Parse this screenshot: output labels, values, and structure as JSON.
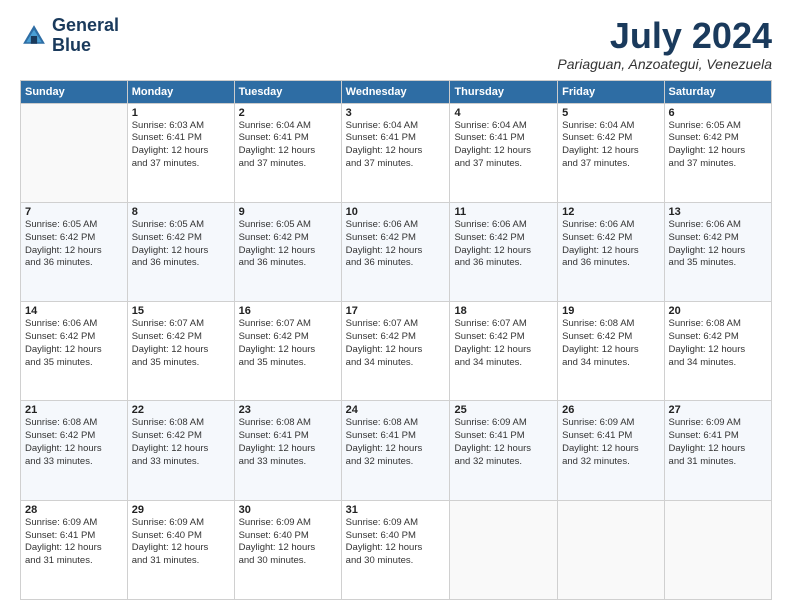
{
  "logo": {
    "line1": "General",
    "line2": "Blue"
  },
  "title": "July 2024",
  "subtitle": "Pariaguan, Anzoategui, Venezuela",
  "weekdays": [
    "Sunday",
    "Monday",
    "Tuesday",
    "Wednesday",
    "Thursday",
    "Friday",
    "Saturday"
  ],
  "weeks": [
    [
      {
        "day": "",
        "info": ""
      },
      {
        "day": "1",
        "info": "Sunrise: 6:03 AM\nSunset: 6:41 PM\nDaylight: 12 hours\nand 37 minutes."
      },
      {
        "day": "2",
        "info": "Sunrise: 6:04 AM\nSunset: 6:41 PM\nDaylight: 12 hours\nand 37 minutes."
      },
      {
        "day": "3",
        "info": "Sunrise: 6:04 AM\nSunset: 6:41 PM\nDaylight: 12 hours\nand 37 minutes."
      },
      {
        "day": "4",
        "info": "Sunrise: 6:04 AM\nSunset: 6:41 PM\nDaylight: 12 hours\nand 37 minutes."
      },
      {
        "day": "5",
        "info": "Sunrise: 6:04 AM\nSunset: 6:42 PM\nDaylight: 12 hours\nand 37 minutes."
      },
      {
        "day": "6",
        "info": "Sunrise: 6:05 AM\nSunset: 6:42 PM\nDaylight: 12 hours\nand 37 minutes."
      }
    ],
    [
      {
        "day": "7",
        "info": "Sunrise: 6:05 AM\nSunset: 6:42 PM\nDaylight: 12 hours\nand 36 minutes."
      },
      {
        "day": "8",
        "info": "Sunrise: 6:05 AM\nSunset: 6:42 PM\nDaylight: 12 hours\nand 36 minutes."
      },
      {
        "day": "9",
        "info": "Sunrise: 6:05 AM\nSunset: 6:42 PM\nDaylight: 12 hours\nand 36 minutes."
      },
      {
        "day": "10",
        "info": "Sunrise: 6:06 AM\nSunset: 6:42 PM\nDaylight: 12 hours\nand 36 minutes."
      },
      {
        "day": "11",
        "info": "Sunrise: 6:06 AM\nSunset: 6:42 PM\nDaylight: 12 hours\nand 36 minutes."
      },
      {
        "day": "12",
        "info": "Sunrise: 6:06 AM\nSunset: 6:42 PM\nDaylight: 12 hours\nand 36 minutes."
      },
      {
        "day": "13",
        "info": "Sunrise: 6:06 AM\nSunset: 6:42 PM\nDaylight: 12 hours\nand 35 minutes."
      }
    ],
    [
      {
        "day": "14",
        "info": "Sunrise: 6:06 AM\nSunset: 6:42 PM\nDaylight: 12 hours\nand 35 minutes."
      },
      {
        "day": "15",
        "info": "Sunrise: 6:07 AM\nSunset: 6:42 PM\nDaylight: 12 hours\nand 35 minutes."
      },
      {
        "day": "16",
        "info": "Sunrise: 6:07 AM\nSunset: 6:42 PM\nDaylight: 12 hours\nand 35 minutes."
      },
      {
        "day": "17",
        "info": "Sunrise: 6:07 AM\nSunset: 6:42 PM\nDaylight: 12 hours\nand 34 minutes."
      },
      {
        "day": "18",
        "info": "Sunrise: 6:07 AM\nSunset: 6:42 PM\nDaylight: 12 hours\nand 34 minutes."
      },
      {
        "day": "19",
        "info": "Sunrise: 6:08 AM\nSunset: 6:42 PM\nDaylight: 12 hours\nand 34 minutes."
      },
      {
        "day": "20",
        "info": "Sunrise: 6:08 AM\nSunset: 6:42 PM\nDaylight: 12 hours\nand 34 minutes."
      }
    ],
    [
      {
        "day": "21",
        "info": "Sunrise: 6:08 AM\nSunset: 6:42 PM\nDaylight: 12 hours\nand 33 minutes."
      },
      {
        "day": "22",
        "info": "Sunrise: 6:08 AM\nSunset: 6:42 PM\nDaylight: 12 hours\nand 33 minutes."
      },
      {
        "day": "23",
        "info": "Sunrise: 6:08 AM\nSunset: 6:41 PM\nDaylight: 12 hours\nand 33 minutes."
      },
      {
        "day": "24",
        "info": "Sunrise: 6:08 AM\nSunset: 6:41 PM\nDaylight: 12 hours\nand 32 minutes."
      },
      {
        "day": "25",
        "info": "Sunrise: 6:09 AM\nSunset: 6:41 PM\nDaylight: 12 hours\nand 32 minutes."
      },
      {
        "day": "26",
        "info": "Sunrise: 6:09 AM\nSunset: 6:41 PM\nDaylight: 12 hours\nand 32 minutes."
      },
      {
        "day": "27",
        "info": "Sunrise: 6:09 AM\nSunset: 6:41 PM\nDaylight: 12 hours\nand 31 minutes."
      }
    ],
    [
      {
        "day": "28",
        "info": "Sunrise: 6:09 AM\nSunset: 6:41 PM\nDaylight: 12 hours\nand 31 minutes."
      },
      {
        "day": "29",
        "info": "Sunrise: 6:09 AM\nSunset: 6:40 PM\nDaylight: 12 hours\nand 31 minutes."
      },
      {
        "day": "30",
        "info": "Sunrise: 6:09 AM\nSunset: 6:40 PM\nDaylight: 12 hours\nand 30 minutes."
      },
      {
        "day": "31",
        "info": "Sunrise: 6:09 AM\nSunset: 6:40 PM\nDaylight: 12 hours\nand 30 minutes."
      },
      {
        "day": "",
        "info": ""
      },
      {
        "day": "",
        "info": ""
      },
      {
        "day": "",
        "info": ""
      }
    ]
  ]
}
